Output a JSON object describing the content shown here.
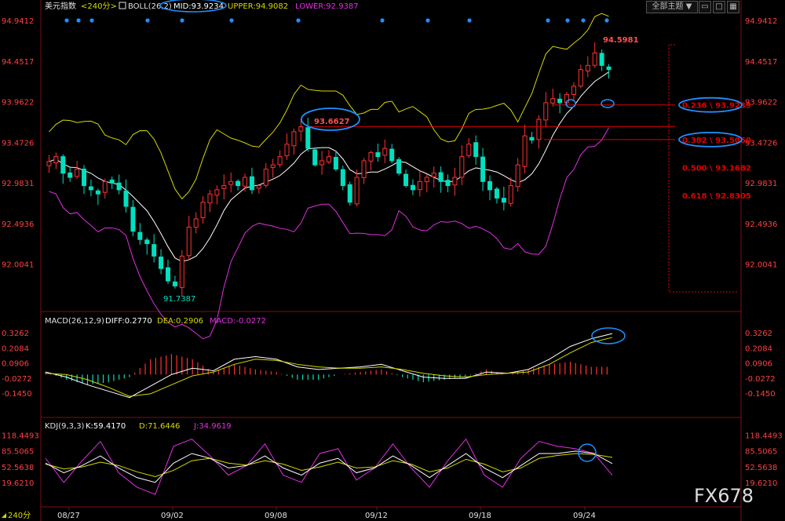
{
  "header": {
    "symbol": "美元指数",
    "period": "<240分>",
    "boll_label": "BOLL(26,2)",
    "mid": "MID:93.9234",
    "upper": "UPPER:94.9082",
    "lower": "LOWER:92.9387",
    "theme_btn": "全部主题",
    "theme_arrow": "▼"
  },
  "macd_header": {
    "label": "MACD(26,12,9)",
    "diff": "DIFF:0.2770",
    "dea": "DEA:0.2906",
    "macd": "MACD:-0.0272"
  },
  "kdj_header": {
    "label": "KDJ(9,3,3)",
    "k": "K:59.4170",
    "d": "D:71.6446",
    "j": "J:34.9619"
  },
  "period_badge": "240分",
  "watermark": "FX678",
  "colors": {
    "up": "#ff3232",
    "down": "#00e0c0",
    "boll_upper": "#d8d800",
    "boll_mid": "#ffffff",
    "boll_lower": "#e030e0",
    "fib_line": "#e00000",
    "highlight_ellipse": "#1e90ff"
  },
  "chart_data": {
    "type": "candlestick",
    "x_ticks": [
      "08/27",
      "09/02",
      "09/08",
      "09/12",
      "09/18",
      "09/24"
    ],
    "main_y_ticks": [
      "94.9412",
      "94.4517",
      "93.9622",
      "93.4726",
      "92.9831",
      "92.4936",
      "92.0041"
    ],
    "main_ylim": [
      91.64,
      95.0
    ],
    "macd_y_ticks": [
      "0.3262",
      "0.2084",
      "0.0906",
      "-0.0272",
      "-0.1450"
    ],
    "macd_ylim": [
      -0.2,
      0.37
    ],
    "kdj_y_ticks": [
      "118.4493",
      "85.5065",
      "52.5638",
      "19.6210"
    ],
    "kdj_ylim": [
      5,
      124
    ],
    "annotations": {
      "high": "94.5981",
      "low": "91.7387",
      "swing_high": "93.6627"
    },
    "fib_levels": [
      {
        "label": "0.236 \\ 93.9239",
        "value": 93.9239
      },
      {
        "label": "0.382 \\ 93.5060",
        "value": 93.506
      },
      {
        "label": "0.500 \\ 93.1682",
        "value": 93.1682
      },
      {
        "label": "0.618 \\ 92.8305",
        "value": 92.8305
      }
    ],
    "close_series": [
      93.24,
      93.3,
      93.1,
      93.05,
      93.15,
      92.95,
      92.9,
      92.85,
      93.0,
      92.98,
      92.9,
      92.7,
      92.4,
      92.3,
      92.25,
      92.1,
      91.95,
      91.8,
      91.74,
      92.1,
      92.45,
      92.55,
      92.75,
      92.85,
      92.9,
      92.95,
      93.0,
      92.95,
      93.05,
      92.9,
      92.95,
      93.15,
      93.2,
      93.3,
      93.45,
      93.6,
      93.66,
      93.4,
      93.2,
      93.25,
      93.3,
      93.15,
      92.95,
      92.75,
      93.05,
      93.25,
      93.35,
      93.3,
      93.4,
      93.25,
      93.1,
      92.95,
      92.9,
      93.0,
      93.05,
      93.1,
      93.0,
      92.95,
      93.05,
      93.3,
      93.45,
      93.3,
      93.0,
      92.9,
      92.8,
      92.75,
      92.95,
      93.2,
      93.55,
      93.5,
      93.75,
      93.95,
      94.0,
      93.95,
      94.05,
      94.15,
      94.35,
      94.4,
      94.55,
      94.4,
      94.35
    ],
    "macd_diff": [
      0.02,
      -0.02,
      -0.08,
      -0.13,
      -0.18,
      -0.09,
      0.0,
      0.05,
      0.03,
      0.12,
      0.14,
      0.12,
      0.06,
      0.04,
      0.05,
      0.06,
      0.08,
      0.03,
      -0.02,
      -0.03,
      -0.03,
      0.02,
      0.01,
      0.04,
      0.12,
      0.22,
      0.28,
      0.32
    ],
    "macd_dea": [
      0.01,
      0.0,
      -0.04,
      -0.1,
      -0.17,
      -0.15,
      -0.08,
      -0.01,
      0.02,
      0.08,
      0.12,
      0.11,
      0.08,
      0.06,
      0.05,
      0.05,
      0.06,
      0.04,
      0.01,
      -0.01,
      -0.02,
      0.0,
      0.01,
      0.02,
      0.08,
      0.17,
      0.25,
      0.29
    ],
    "kdj_k": [
      60,
      40,
      55,
      75,
      50,
      30,
      20,
      60,
      80,
      70,
      50,
      55,
      75,
      50,
      35,
      60,
      70,
      40,
      50,
      75,
      55,
      30,
      55,
      80,
      50,
      30,
      55,
      80,
      80,
      85,
      80,
      59
    ],
    "kdj_d": [
      58,
      48,
      52,
      62,
      55,
      42,
      32,
      45,
      65,
      70,
      60,
      56,
      65,
      58,
      45,
      52,
      62,
      50,
      52,
      65,
      58,
      42,
      50,
      68,
      58,
      42,
      50,
      70,
      76,
      80,
      78,
      72
    ],
    "kdj_j": [
      70,
      20,
      65,
      105,
      40,
      10,
      -5,
      95,
      110,
      75,
      35,
      55,
      100,
      35,
      20,
      80,
      90,
      25,
      50,
      100,
      50,
      10,
      65,
      110,
      35,
      10,
      70,
      105,
      95,
      90,
      80,
      35
    ]
  }
}
